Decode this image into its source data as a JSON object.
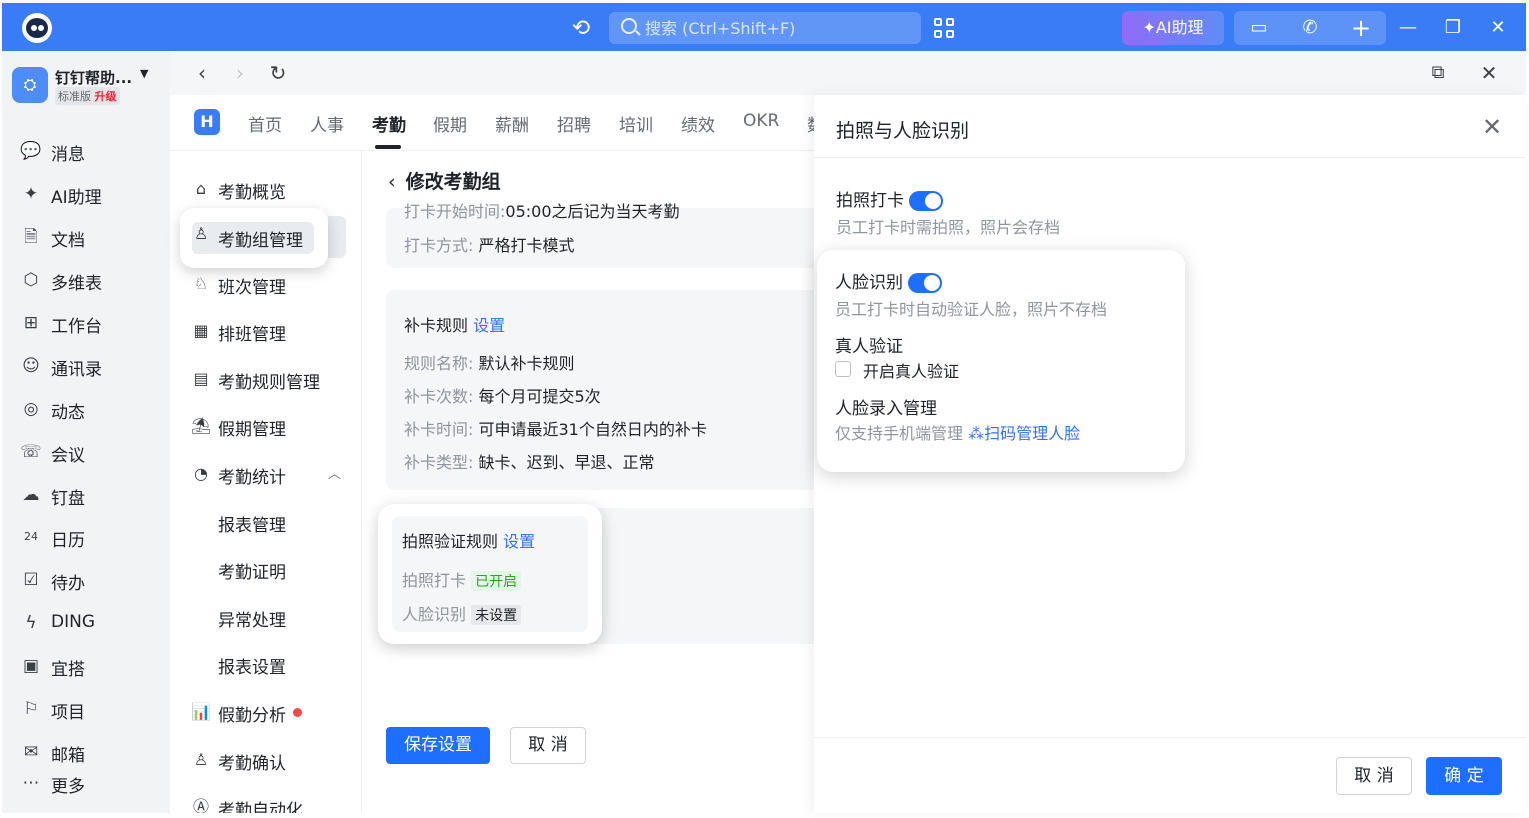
{
  "titlebar": {
    "search_placeholder": "搜索 (Ctrl+Shift+F)",
    "ai_button": "AI助理",
    "icons": [
      "history-icon",
      "search-icon",
      "apps-icon",
      "ai-sparkle-icon",
      "screen-share-icon",
      "phone-icon",
      "plus-icon",
      "minimize-icon",
      "restore-icon",
      "close-icon"
    ]
  },
  "org": {
    "name": "钉钉帮助...",
    "edition": "标准版",
    "upgrade": "升级"
  },
  "sidebar": {
    "items": [
      {
        "label": "消息",
        "icon": "message-icon",
        "glyph": "💬"
      },
      {
        "label": "AI助理",
        "icon": "ai-icon",
        "glyph": "✦"
      },
      {
        "label": "文档",
        "icon": "doc-icon",
        "glyph": "🗎"
      },
      {
        "label": "多维表",
        "icon": "table-icon",
        "glyph": "⬡"
      },
      {
        "label": "工作台",
        "icon": "workbench-icon",
        "glyph": "⊞"
      },
      {
        "label": "通讯录",
        "icon": "contacts-icon",
        "glyph": "☺"
      },
      {
        "label": "动态",
        "icon": "feed-icon",
        "glyph": "◎"
      },
      {
        "label": "会议",
        "icon": "meeting-icon",
        "glyph": "☏"
      },
      {
        "label": "钉盘",
        "icon": "cloud-icon",
        "glyph": "☁"
      },
      {
        "label": "日历",
        "icon": "calendar-icon",
        "glyph": "24"
      },
      {
        "label": "待办",
        "icon": "todo-icon",
        "glyph": "☑"
      },
      {
        "label": "DING",
        "icon": "ding-icon",
        "glyph": "ϟ"
      },
      {
        "label": "宜搭",
        "icon": "yida-icon",
        "glyph": "▣"
      },
      {
        "label": "项目",
        "icon": "project-icon",
        "glyph": "⚐"
      },
      {
        "label": "邮箱",
        "icon": "mail-icon",
        "glyph": "✉"
      },
      {
        "label": "更多",
        "icon": "more-icon",
        "glyph": "⋯"
      }
    ]
  },
  "module": {
    "tabs": [
      "首页",
      "人事",
      "考勤",
      "假期",
      "薪酬",
      "招聘",
      "培训",
      "绩效",
      "OKR",
      "数"
    ],
    "active_tab": "考勤"
  },
  "subnav": {
    "items": [
      {
        "label": "考勤概览",
        "icon": "home-icon",
        "glyph": "⌂"
      },
      {
        "label": "考勤组管理",
        "icon": "group-user-icon",
        "glyph": "♙"
      },
      {
        "label": "班次管理",
        "icon": "shift-icon",
        "glyph": "♘"
      },
      {
        "label": "排班管理",
        "icon": "schedule-icon",
        "glyph": "▦"
      },
      {
        "label": "考勤规则管理",
        "icon": "rule-icon",
        "glyph": "▤"
      },
      {
        "label": "假期管理",
        "icon": "holiday-icon",
        "glyph": "⛱"
      },
      {
        "label": "考勤统计",
        "icon": "stats-icon",
        "glyph": "◔"
      },
      {
        "label": "报表管理",
        "icon": "",
        "glyph": ""
      },
      {
        "label": "考勤证明",
        "icon": "",
        "glyph": ""
      },
      {
        "label": "异常处理",
        "icon": "",
        "glyph": ""
      },
      {
        "label": "报表设置",
        "icon": "",
        "glyph": ""
      },
      {
        "label": "假勤分析",
        "icon": "chart-icon",
        "glyph": "📊"
      },
      {
        "label": "考勤确认",
        "icon": "confirm-user-icon",
        "glyph": "♙"
      },
      {
        "label": "考勤自动化",
        "icon": "automation-icon",
        "glyph": "Ⓐ"
      }
    ]
  },
  "content": {
    "title": "修改考勤组",
    "cut_row": {
      "k": "打卡开始时间:",
      "v": "05:00之后记为当天考勤"
    },
    "punch_mode": {
      "k": "打卡方式:",
      "v": "严格打卡模式"
    },
    "makeup": {
      "header": "补卡规则",
      "link": "设置",
      "rows": [
        {
          "k": "规则名称:",
          "v": "默认补卡规则"
        },
        {
          "k": "补卡次数:",
          "v": "每个月可提交5次"
        },
        {
          "k": "补卡时间:",
          "v": "可申请最近31个自然日内的补卡"
        },
        {
          "k": "补卡类型:",
          "v": "缺卡、迟到、早退、正常"
        }
      ]
    },
    "photo_rule": {
      "header": "拍照验证规则",
      "link": "设置",
      "rows": [
        {
          "k": "拍照打卡",
          "tag": "已开启"
        },
        {
          "k": "人脸识别",
          "tag": "未设置"
        }
      ]
    },
    "save_button": "保存设置",
    "cancel_button": "取 消"
  },
  "drawer": {
    "title": "拍照与人脸识别",
    "photo_punch": {
      "label": "拍照打卡",
      "on": true,
      "desc": "员工打卡时需拍照，照片会存档"
    },
    "face": {
      "label": "人脸识别",
      "on": true,
      "desc": "员工打卡时自动验证人脸，照片不存档"
    },
    "liveness": {
      "label": "真人验证",
      "checkbox": "开启真人验证",
      "checked": false
    },
    "face_entry": {
      "label": "人脸录入管理",
      "desc": "仅支持手机端管理",
      "link": "扫码管理人脸"
    },
    "cancel": "取 消",
    "confirm": "确 定"
  }
}
